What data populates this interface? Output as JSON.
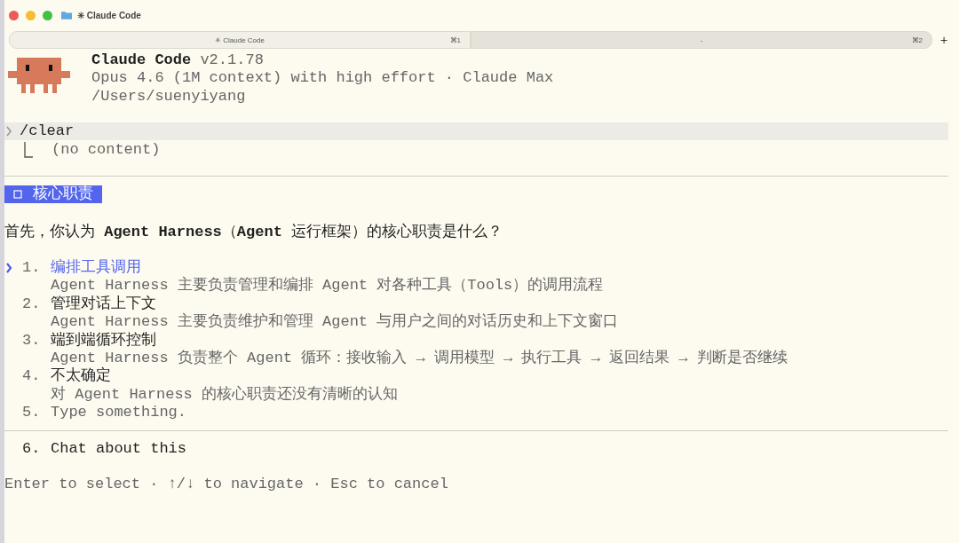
{
  "window": {
    "title": "✳ Claude Code"
  },
  "tabs": [
    {
      "label": "✳ Claude Code",
      "shortcut": "⌘1",
      "selected": true
    },
    {
      "label": "-",
      "shortcut": "⌘2",
      "selected": false
    }
  ],
  "new_tab_button": "+",
  "header": {
    "name": "Claude Code",
    "version": "v2.1.78",
    "model": "Opus 4.6 (1M context) with high effort · Claude Max",
    "path": "/Users/suenyiyang"
  },
  "history": {
    "command": "/clear",
    "result": "(no content)"
  },
  "question": {
    "tag": "核心职责",
    "text": "首先，你认为 **Agent Harness**（**Agent** 运行框架）的核心职责是什么？"
  },
  "options": [
    {
      "number": "1.",
      "label": "编排工具调用",
      "description": "Agent Harness 主要负责管理和编排 Agent 对各种工具（Tools）的调用流程",
      "selected": true
    },
    {
      "number": "2.",
      "label": "管理对话上下文",
      "description": "Agent Harness 主要负责维护和管理 Agent 与用户之间的对话历史和上下文窗口",
      "selected": false
    },
    {
      "number": "3.",
      "label": "端到端循环控制",
      "description": "Agent Harness 负责整个 Agent 循环：接收输入 → 调用模型 → 执行工具 → 返回结果 → 判断是否继续",
      "selected": false
    },
    {
      "number": "4.",
      "label": "不太确定",
      "description": "对 Agent Harness 的核心职责还没有清晰的认知",
      "selected": false
    },
    {
      "number": "5.",
      "label": "Type something.",
      "kind": "input",
      "selected": false
    }
  ],
  "chat_option": {
    "number": "6.",
    "label": "Chat about this"
  },
  "hint": "Enter to select · ↑/↓ to navigate · Esc to cancel"
}
